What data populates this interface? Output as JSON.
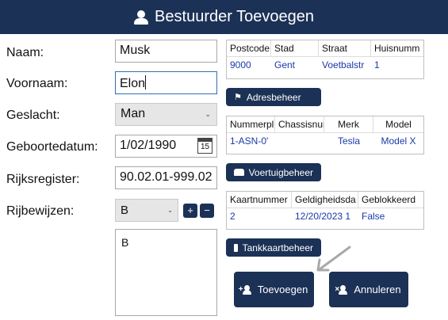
{
  "window": {
    "title": "Bestuurder Toevoegen",
    "icon": "user-icon"
  },
  "colors": {
    "primary": "#1b3156",
    "link": "#1a3aa8",
    "focus_border": "#2f6fb3"
  },
  "form": {
    "naam": {
      "label": "Naam:",
      "value": "Musk"
    },
    "voornaam": {
      "label": "Voornaam:",
      "value": "Elon"
    },
    "geslacht": {
      "label": "Geslacht:",
      "value": "Man"
    },
    "geboortedatum": {
      "label": "Geboortedatum:",
      "value": "1/02/1990",
      "calendar_day": "15"
    },
    "rijksregister": {
      "label": "Rijksregister:",
      "value": "90.02.01-999.02"
    },
    "rijbewijzen": {
      "label": "Rijbewijzen:",
      "selected": "B",
      "add": "+",
      "remove": "−",
      "list": [
        "B"
      ]
    }
  },
  "adres": {
    "headers": [
      "Postcode",
      "Stad",
      "Straat",
      "Huisnumm"
    ],
    "rows": [
      [
        "9000",
        "Gent",
        "Voetbalstr",
        "1"
      ]
    ],
    "button": "Adresbeheer"
  },
  "voertuig": {
    "headers": [
      "Nummerpl",
      "Chassisnur",
      "Merk",
      "Model"
    ],
    "rows": [
      [
        "1-ASN-0'",
        "",
        "Tesla",
        "Model X"
      ]
    ],
    "button": "Voertuigbeheer"
  },
  "tankkaart": {
    "headers": [
      "Kaartnummer",
      "Geldigheidsda",
      "Geblokkeerd"
    ],
    "rows": [
      [
        "2",
        "12/20/2023 1",
        "False"
      ]
    ],
    "button": "Tankkaartbeheer"
  },
  "actions": {
    "toevoegen": "Toevoegen",
    "annuleren": "Annuleren"
  }
}
